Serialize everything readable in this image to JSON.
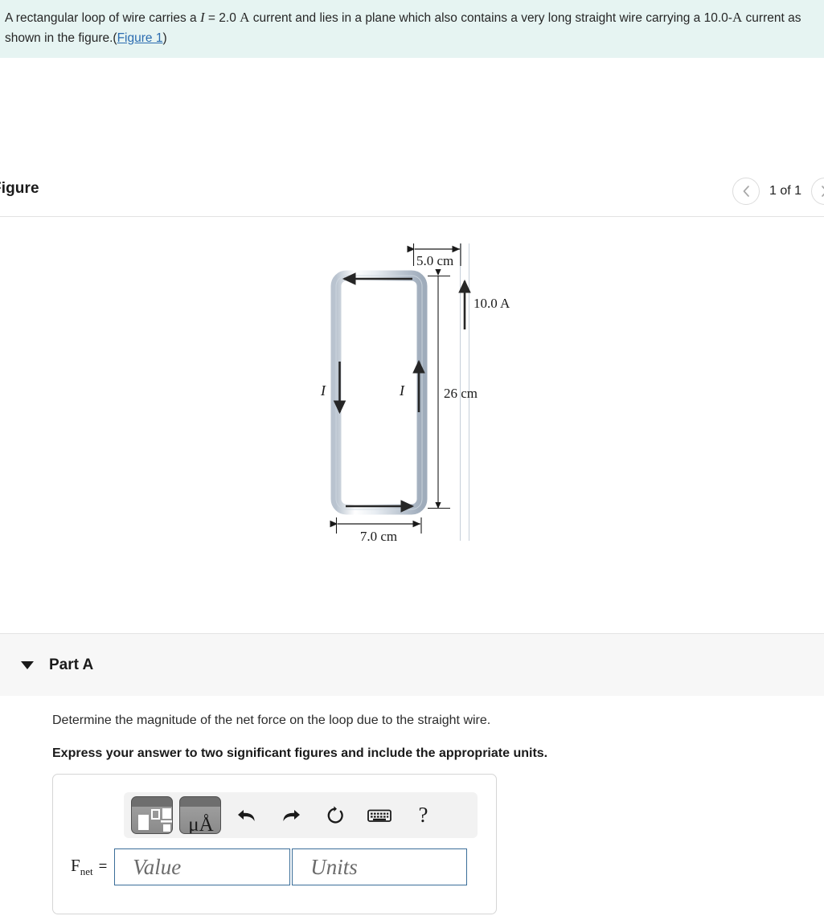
{
  "statement": {
    "part1": "A rectangular loop of wire carries a ",
    "current_symbol": "I",
    "eq": " = 2.0 ",
    "amp_unit": "A",
    "part2": " current and lies in a plane which also contains a very long straight wire carrying a 10.0-",
    "amp_unit2": "A",
    "part3": " current as shown in the figure.(",
    "link_text": "Figure 1",
    "part4": ")"
  },
  "figure": {
    "title": "Figure",
    "counter": "1 of 1",
    "prev_icon": "chevron-left-icon",
    "next_icon": "chevron-right-icon",
    "diagram": {
      "top_distance_label": "5.0 cm",
      "loop_height_label": "26 cm",
      "loop_width_label": "7.0 cm",
      "wire_current_label": "10.0 A",
      "loop_current_left_label": "I",
      "loop_current_right_label": "I",
      "wire_color": "#c3ccd6",
      "wire_highlight": "#ffffff",
      "arrow_color": "#262626"
    }
  },
  "part": {
    "caret_icon": "caret-down-icon",
    "label": "Part A",
    "question": "Determine the magnitude of the net force on the loop due to the straight wire.",
    "instruction": "Express your answer to two significant figures and include the appropriate units."
  },
  "answer": {
    "toolbar": {
      "template_icon": "math-template-icon",
      "units_icon": "units-icon",
      "units_icon_text": "μÅ",
      "undo_icon": "undo-icon",
      "redo_icon": "redo-icon",
      "reset_icon": "reset-icon",
      "keyboard_icon": "keyboard-icon",
      "help_icon": "help-icon",
      "help_label": "?"
    },
    "field_label": "F",
    "field_label_sub": "net",
    "equals": "=",
    "value_placeholder": "Value",
    "value_current": "",
    "units_placeholder": "Units",
    "units_current": ""
  },
  "colors": {
    "banner_bg": "#e6f4f2",
    "link": "#2b6cb0",
    "part_header_bg": "#f7f7f7",
    "input_border": "#3b6e99"
  }
}
